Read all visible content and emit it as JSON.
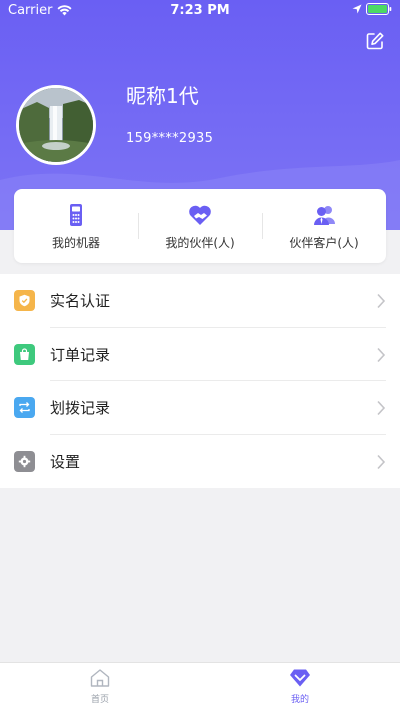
{
  "status_bar": {
    "carrier": "Carrier",
    "time": "7:23 PM"
  },
  "profile": {
    "nickname": "昵称1代",
    "phone": "159****2935"
  },
  "stats": [
    {
      "label": "我的机器",
      "icon": "phone-calculator-icon"
    },
    {
      "label": "我的伙伴(人)",
      "icon": "handshake-heart-icon"
    },
    {
      "label": "伙伴客户(人)",
      "icon": "users-icon"
    }
  ],
  "menu": [
    {
      "label": "实名认证",
      "icon": "shield-check-icon",
      "color": "#f5b54a"
    },
    {
      "label": "订单记录",
      "icon": "order-bag-icon",
      "color": "#3ec97d"
    },
    {
      "label": "划拨记录",
      "icon": "transfer-arrows-icon",
      "color": "#4aa8f0"
    },
    {
      "label": "设置",
      "icon": "gear-icon",
      "color": "#8e8e93"
    }
  ],
  "tabbar": [
    {
      "label": "首页",
      "icon": "home-icon",
      "active": false
    },
    {
      "label": "我的",
      "icon": "diamond-chevron-icon",
      "active": true
    }
  ],
  "colors": {
    "accent": "#6a5ff3",
    "background": "#f1f1f3"
  }
}
